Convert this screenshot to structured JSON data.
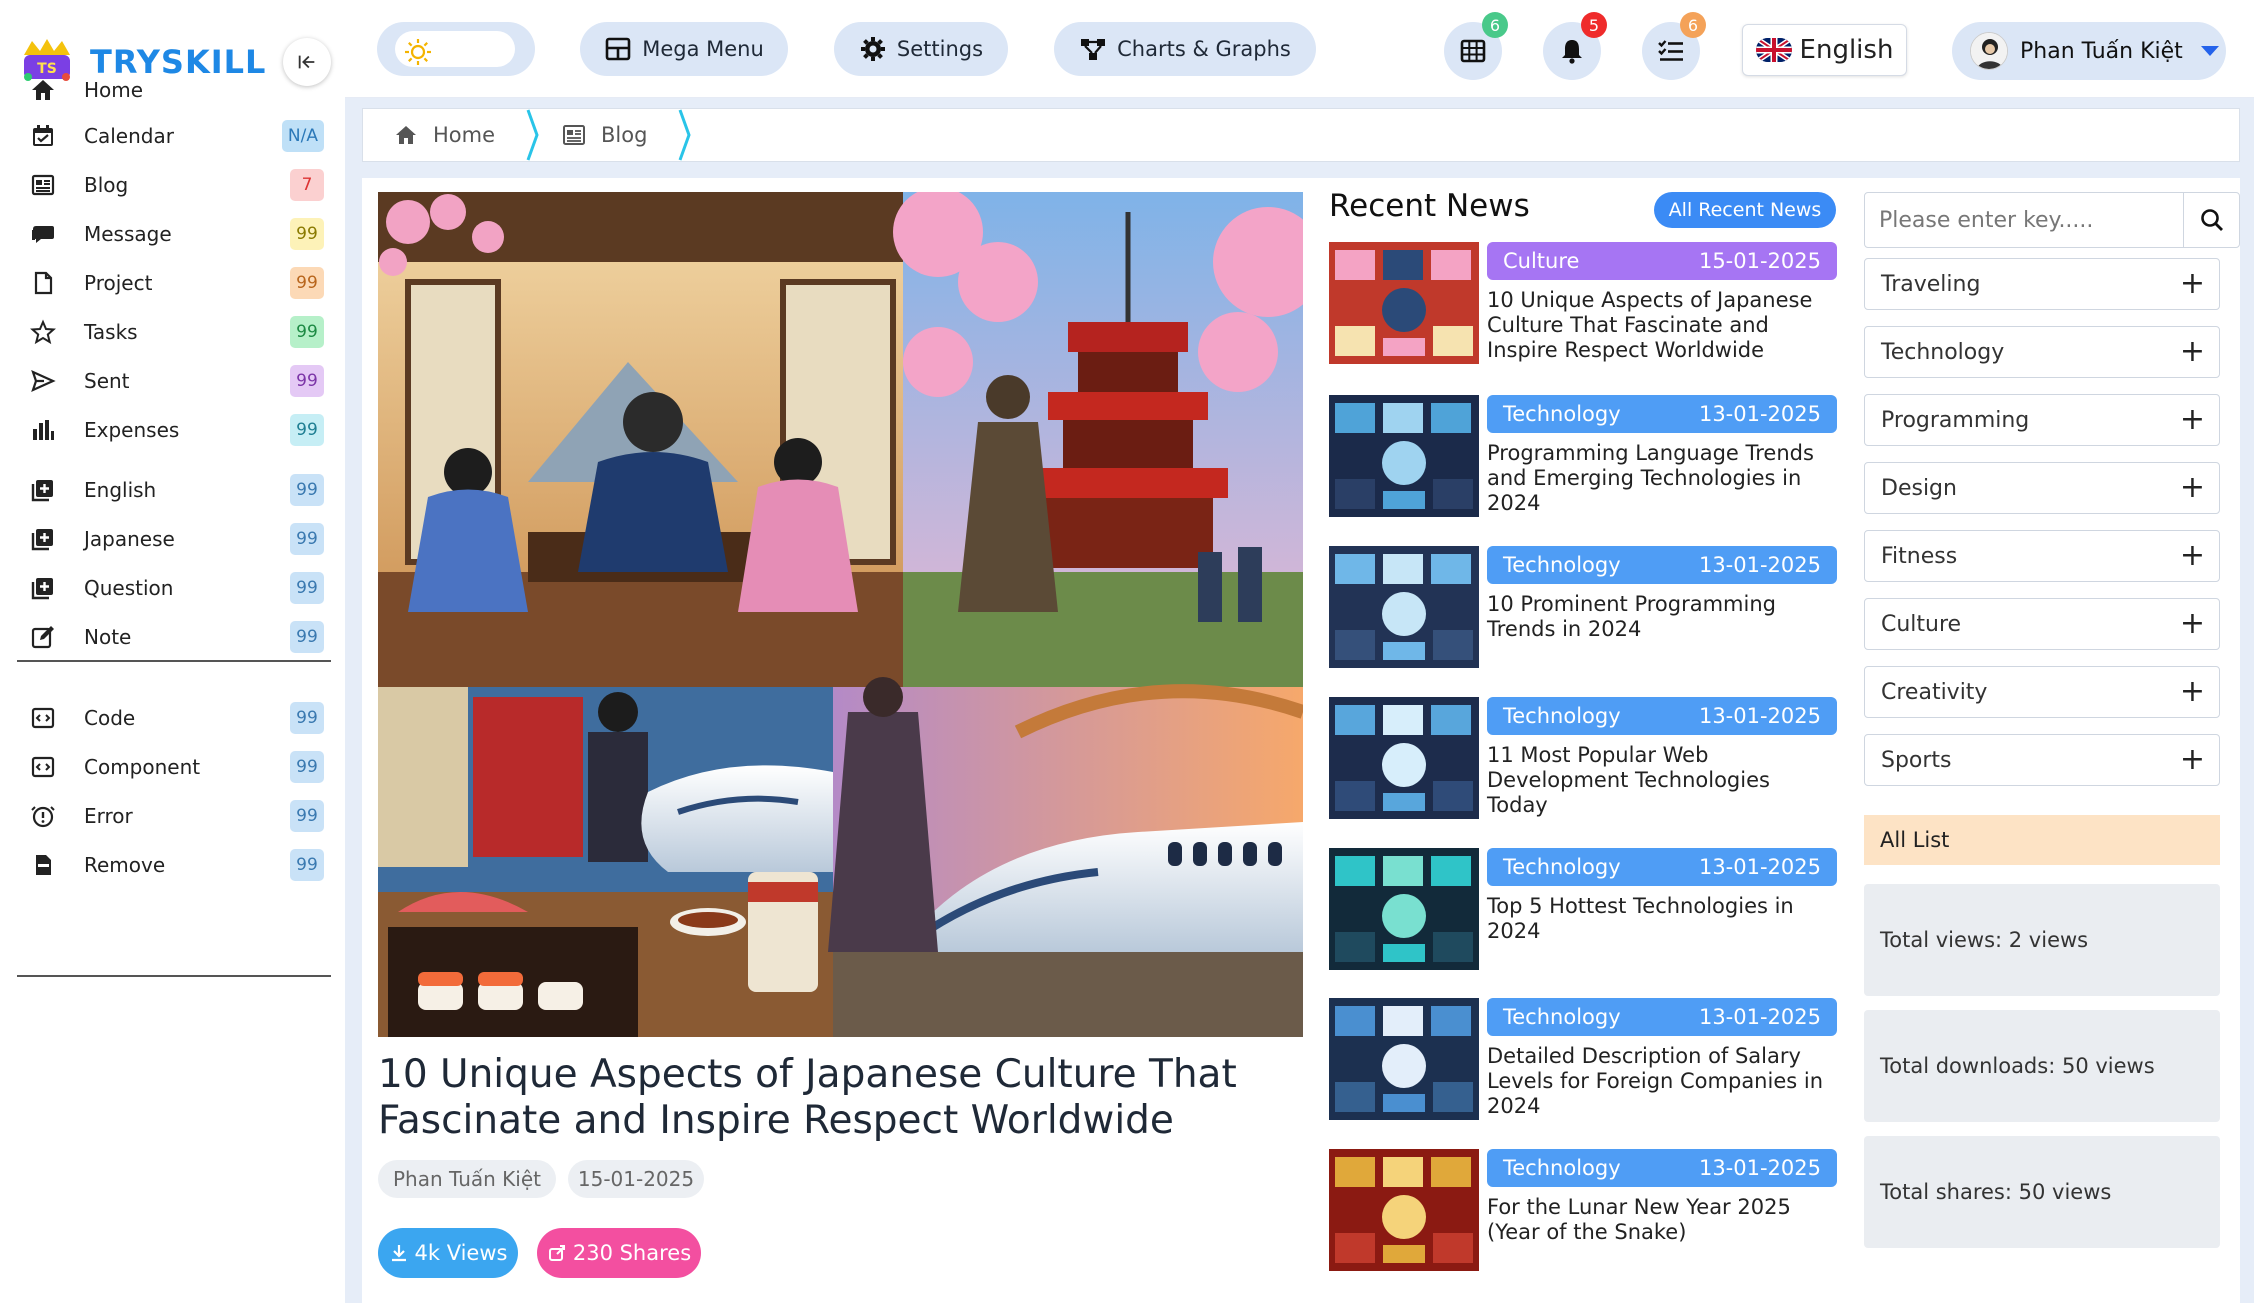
{
  "brand": {
    "name": "TRYSKILL"
  },
  "sidebar": {
    "items": [
      {
        "label": "Home",
        "badge": "",
        "icon": "home-icon"
      },
      {
        "label": "Calendar",
        "badge": "N/A",
        "badge_bg": "#bfe0f7",
        "badge_fg": "#2b78b8",
        "icon": "calendar-icon"
      },
      {
        "label": "Blog",
        "badge": "7",
        "badge_bg": "#fbd0d0",
        "badge_fg": "#d33",
        "icon": "newspaper-icon"
      },
      {
        "label": "Message",
        "badge": "99",
        "badge_bg": "#fdf2b8",
        "badge_fg": "#8a7a00",
        "icon": "chat-icon"
      },
      {
        "label": "Project",
        "badge": "99",
        "badge_bg": "#fcd9b6",
        "badge_fg": "#b8651c",
        "icon": "file-icon"
      },
      {
        "label": "Tasks",
        "badge": "99",
        "badge_bg": "#b6f0c9",
        "badge_fg": "#1d8a44",
        "icon": "star-icon"
      },
      {
        "label": "Sent",
        "badge": "99",
        "badge_bg": "#e4c9f5",
        "badge_fg": "#7c35a8",
        "icon": "send-icon"
      },
      {
        "label": "Expenses",
        "badge": "99",
        "badge_bg": "#c6eef5",
        "badge_fg": "#1f7f93",
        "icon": "bar-chart-icon"
      },
      {
        "label": "English",
        "badge": "99",
        "badge_bg": "#c9e2f7",
        "badge_fg": "#3a79b0",
        "icon": "add-box-icon"
      },
      {
        "label": "Japanese",
        "badge": "99",
        "badge_bg": "#c9e2f7",
        "badge_fg": "#3a79b0",
        "icon": "add-box-icon"
      },
      {
        "label": "Question",
        "badge": "99",
        "badge_bg": "#c9e2f7",
        "badge_fg": "#3a79b0",
        "icon": "add-box-icon"
      },
      {
        "label": "Note",
        "badge": "99",
        "badge_bg": "#c9e2f7",
        "badge_fg": "#3a79b0",
        "icon": "edit-icon"
      },
      {
        "label": "Code",
        "badge": "99",
        "badge_bg": "#c9e2f7",
        "badge_fg": "#3a79b0",
        "icon": "code-icon"
      },
      {
        "label": "Component",
        "badge": "99",
        "badge_bg": "#c9e2f7",
        "badge_fg": "#3a79b0",
        "icon": "code-icon"
      },
      {
        "label": "Error",
        "badge": "99",
        "badge_bg": "#c9e2f7",
        "badge_fg": "#3a79b0",
        "icon": "alert-clock-icon"
      },
      {
        "label": "Remove",
        "badge": "99",
        "badge_bg": "#c9e2f7",
        "badge_fg": "#3a79b0",
        "icon": "minus-box-icon"
      }
    ]
  },
  "topbar": {
    "mega_menu": "Mega Menu",
    "settings": "Settings",
    "charts": "Charts & Graphs",
    "apps_count": "6",
    "notif_count": "5",
    "tasks_count": "6",
    "language": "English",
    "user_name": "Phan Tuấn Kiệt"
  },
  "breadcrumb": {
    "home": "Home",
    "current": "Blog"
  },
  "featured": {
    "title": "10 Unique Aspects of Japanese Culture That Fascinate and Inspire Respect Worldwide",
    "author": "Phan Tuấn Kiệt",
    "date": "15-01-2025",
    "views": "4k Views",
    "shares": "230 Shares"
  },
  "recent": {
    "title": "Recent News",
    "all_label": "All Recent News",
    "items": [
      {
        "category": "Culture",
        "date": "15-01-2025",
        "color": "#a675f3",
        "text": "10 Unique Aspects of Japanese Culture That Fascinate and Inspire Respect Worldwide"
      },
      {
        "category": "Technology",
        "date": "13-01-2025",
        "color": "#4f9df5",
        "text": "Programming Language Trends and Emerging Technologies in 2024"
      },
      {
        "category": "Technology",
        "date": "13-01-2025",
        "color": "#4f9df5",
        "text": "10 Prominent Programming Trends in 2024"
      },
      {
        "category": "Technology",
        "date": "13-01-2025",
        "color": "#4f9df5",
        "text": "11 Most Popular Web Development Technologies Today"
      },
      {
        "category": "Technology",
        "date": "13-01-2025",
        "color": "#4f9df5",
        "text": "Top 5 Hottest Technologies in 2024"
      },
      {
        "category": "Technology",
        "date": "13-01-2025",
        "color": "#4f9df5",
        "text": "Detailed Description of Salary Levels for Foreign Companies in 2024"
      },
      {
        "category": "Technology",
        "date": "13-01-2025",
        "color": "#4f9df5",
        "text": "For the Lunar New Year 2025 (Year of the Snake)"
      }
    ]
  },
  "search": {
    "placeholder": "Please enter key....."
  },
  "categories": [
    "Traveling",
    "Technology",
    "Programming",
    "Design",
    "Fitness",
    "Culture",
    "Creativity",
    "Sports"
  ],
  "all_list": {
    "label": "All List",
    "totals": [
      "Total views: 2 views",
      "Total downloads: 50 views",
      "Total shares: 50 views"
    ]
  }
}
